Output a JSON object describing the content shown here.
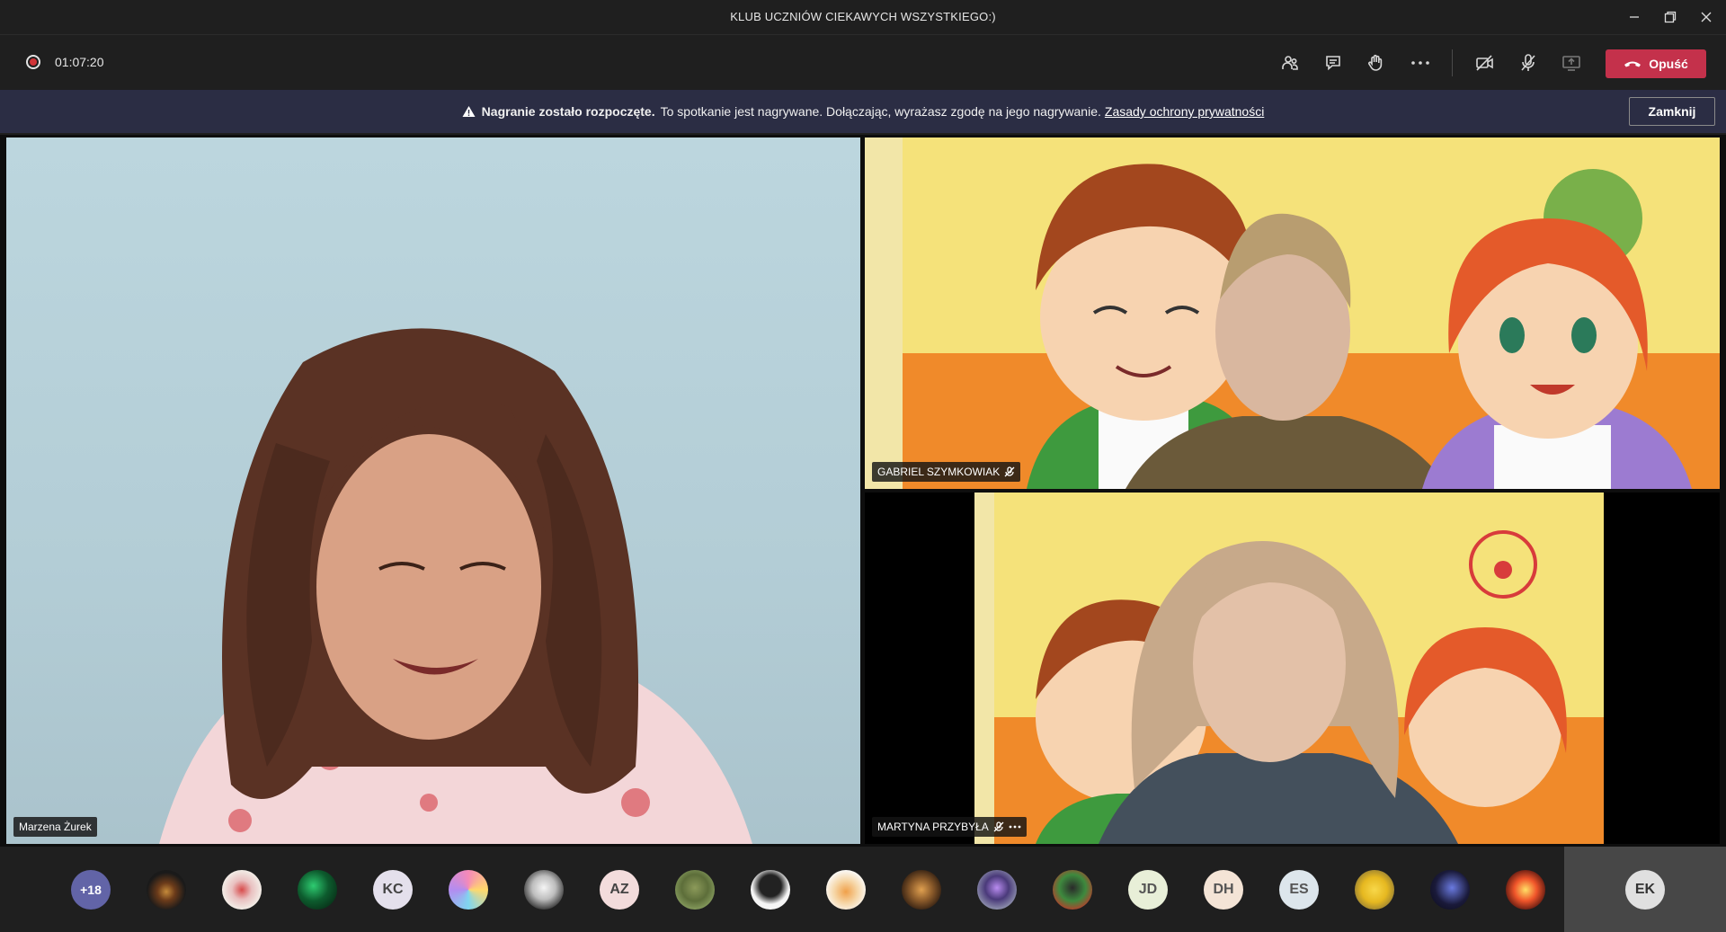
{
  "window": {
    "title": "KLUB UCZNIÓW CIEKAWYCH WSZYSTKIEGO:)",
    "controls": [
      "minimize-icon",
      "restore-icon",
      "close-icon"
    ]
  },
  "toolbar": {
    "recording_time": "01:07:20",
    "buttons": [
      "people-icon",
      "chat-icon",
      "raise-hand-icon",
      "more-icon",
      "camera-off-icon",
      "mic-off-icon",
      "share-screen-icon"
    ],
    "leave_label": "Opuść",
    "leave_color": "#c4314b"
  },
  "banner": {
    "bold": "Nagranie zostało rozpoczęte.",
    "text": "To spotkanie jest nagrywane. Dołączając, wyrażasz zgodę na jego nagrywanie.",
    "link": "Zasady ochrony prywatności",
    "close_label": "Zamknij",
    "background": "#2b2d44"
  },
  "videos": [
    {
      "name": "Marzena Żurek"
    },
    {
      "name": "GABRIEL SZYMKOWIAK"
    },
    {
      "name": "MARTYNA PRZYBYŁA"
    }
  ],
  "participants": {
    "overflow": "+18",
    "initials": {
      "kc": "KC",
      "az": "AZ",
      "jd": "JD",
      "dh": "DH",
      "es": "ES"
    },
    "self": "EK"
  }
}
